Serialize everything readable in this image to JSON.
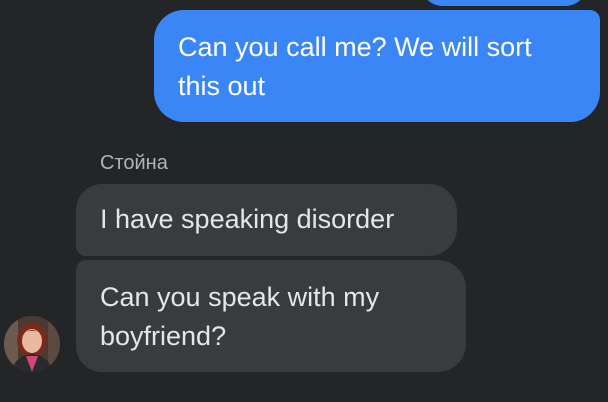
{
  "messages": [
    {
      "direction": "outgoing",
      "text": "Can you call me? We will sort this out"
    },
    {
      "direction": "incoming",
      "sender": "Стойна",
      "text": "I have speaking disorder"
    },
    {
      "direction": "incoming",
      "sender": "Стойна",
      "text": "Can you speak with my boyfriend?"
    }
  ],
  "colors": {
    "background": "#242526",
    "outgoing_bubble": "#3b86f6",
    "incoming_bubble": "#3a3b3c",
    "sender_name": "#b0b3b8"
  },
  "icons": {
    "avatar": "contact-avatar-photo"
  }
}
